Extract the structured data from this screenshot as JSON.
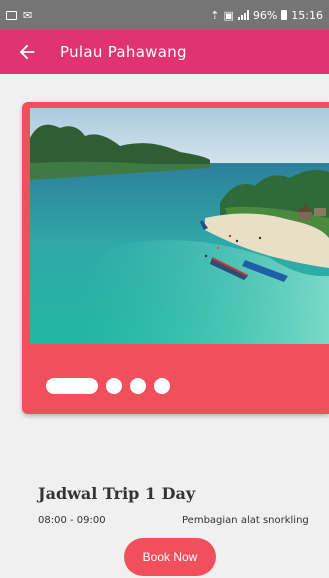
{
  "status_bar": {
    "battery": "96%",
    "time": "15:16"
  },
  "app_bar": {
    "title": "Pulau Pahawang",
    "back_icon": "arrow-left-icon",
    "background_color": "#e0336f"
  },
  "carousel": {
    "slide_count": 4,
    "active_index": 0,
    "card_color": "#f0505c"
  },
  "schedule": {
    "title": "Jadwal Trip 1 Day",
    "items": [
      {
        "time": "08:00 - 09:00",
        "activity": "Pembagian alat snorkling"
      }
    ]
  },
  "book_button": {
    "label": "Book Now",
    "color": "#f0505c"
  }
}
